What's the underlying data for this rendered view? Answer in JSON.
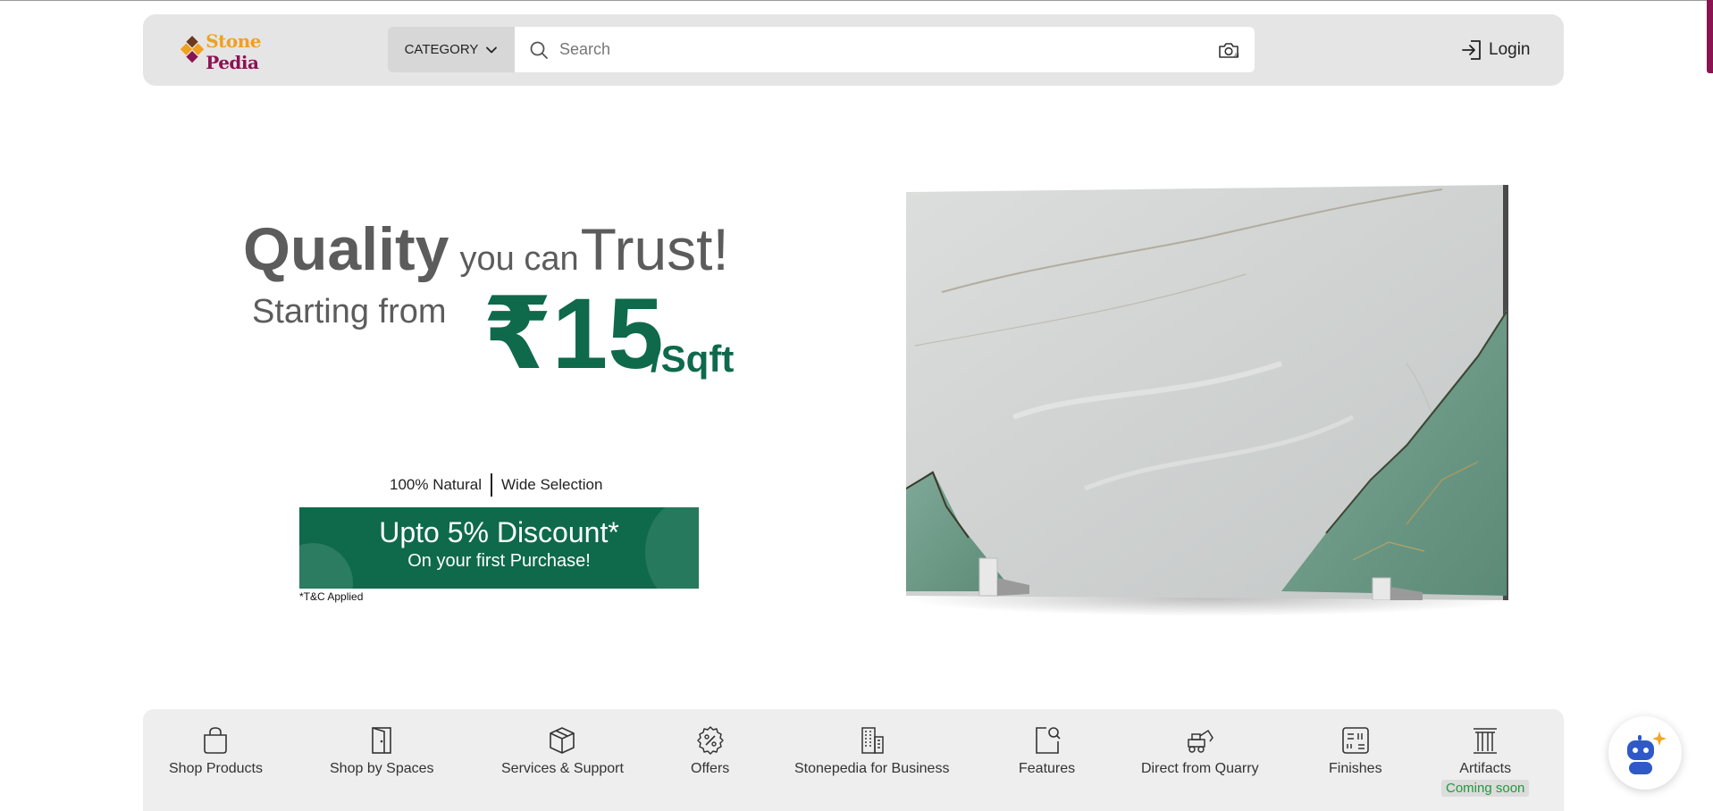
{
  "header": {
    "logo": {
      "word1": "Stone",
      "word2": "Pedia",
      "brand_color_primary": "#f0a020",
      "brand_color_secondary": "#8a1452"
    },
    "category_label": "CATEGORY",
    "search": {
      "placeholder": "Search",
      "value": ""
    },
    "login_label": "Login"
  },
  "hero": {
    "line1_bold": "Quality",
    "line1_small": "you can",
    "line1_large": "Trust!",
    "line2": "Starting from",
    "price": "₹15",
    "unit": "/Sqft",
    "features": [
      "100% Natural",
      "Wide Selection"
    ],
    "promo_title": "Upto 5% Discount*",
    "promo_subtitle": "On your first Purchase!",
    "tnc": "*T&C Applied",
    "accent_color": "#0e6a4a"
  },
  "bottom_nav": {
    "items": [
      {
        "label": "Shop Products",
        "icon": "shopping-bag-icon"
      },
      {
        "label": "Shop by Spaces",
        "icon": "door-icon"
      },
      {
        "label": "Services & Support",
        "icon": "box-icon"
      },
      {
        "label": "Offers",
        "icon": "percent-badge-icon"
      },
      {
        "label": "Stonepedia for Business",
        "icon": "buildings-icon"
      },
      {
        "label": "Features",
        "icon": "search-document-icon"
      },
      {
        "label": "Direct from Quarry",
        "icon": "excavator-icon"
      },
      {
        "label": "Finishes",
        "icon": "finishes-grid-icon"
      },
      {
        "label": "Artifacts",
        "icon": "pillar-icon",
        "badge": "Coming soon"
      }
    ]
  },
  "chatbot": {
    "icon": "robot-icon"
  }
}
